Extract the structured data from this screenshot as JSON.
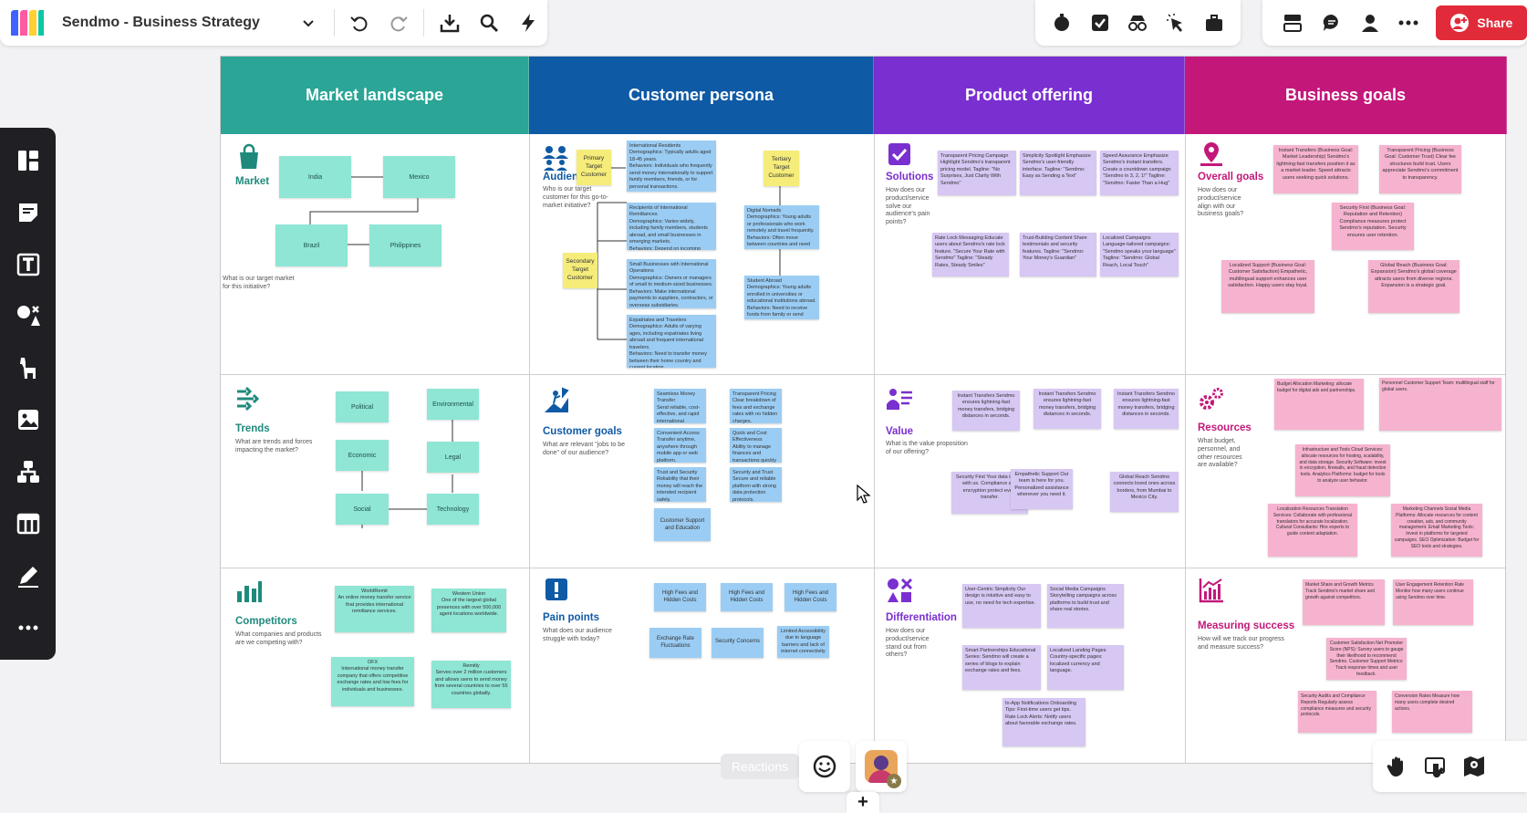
{
  "app": {
    "title": "Sendmo - Business Strategy",
    "share_label": "Share"
  },
  "toolbar": {
    "left_icons": [
      "chevron-down-icon",
      "undo-icon",
      "redo-icon",
      "download-icon",
      "search-icon",
      "lightning-icon"
    ],
    "right_icons": [
      "timer-icon",
      "checkbox-icon",
      "spy-icon",
      "pointer-icon",
      "briefcase-icon"
    ],
    "collab_icons": [
      "cards-icon",
      "chat-icon",
      "user-icon",
      "more-icon"
    ]
  },
  "sidebar": [
    "templates-icon",
    "sticky-note-icon",
    "text-icon",
    "shapes-icon",
    "llama-icon",
    "image-icon",
    "mindmap-icon",
    "table-icon",
    "pen-icon",
    "more-icon"
  ],
  "columns": [
    {
      "title": "Market landscape",
      "color": "#2aa596"
    },
    {
      "title": "Customer persona",
      "color": "#0f5aa5"
    },
    {
      "title": "Product offering",
      "color": "#7a2fd0"
    },
    {
      "title": "Business goals",
      "color": "#c3187a"
    }
  ],
  "sections": {
    "market": {
      "title": "Market",
      "q": "What is our target market for this initiative?"
    },
    "trends": {
      "title": "Trends",
      "q": "What are trends and forces impacting the market?"
    },
    "competitors": {
      "title": "Competitors",
      "q": "What companies and products are we competing with?"
    },
    "audience": {
      "title": "Audience",
      "q": "Who is our target customer for this go-to-market initiative?"
    },
    "cust_goals": {
      "title": "Customer goals",
      "q": "What are relevant \"jobs to be done\" of our audience?"
    },
    "pain": {
      "title": "Pain points",
      "q": "What does our audience struggle with today?"
    },
    "solutions": {
      "title": "Solutions",
      "q": "How does our product/service solve our audience's pain points?"
    },
    "value": {
      "title": "Value",
      "q": "What is the value proposition of our offering?"
    },
    "diff": {
      "title": "Differentiation",
      "q": "How does our product/service stand out from others?"
    },
    "overall": {
      "title": "Overall goals",
      "q": "How does our product/service align with our business goals?"
    },
    "resources": {
      "title": "Resources",
      "q": "What budget, personnel, and other resources are available?"
    },
    "measuring": {
      "title": "Measuring success",
      "q": "How will we track our progress and measure success?"
    }
  },
  "market_boxes": [
    "India",
    "Mexico",
    "Brazil",
    "Philippines"
  ],
  "trend_boxes": [
    "Political",
    "Environmental",
    "Economic",
    "Legal",
    "Social",
    "Technology"
  ],
  "competitor_notes": [
    "WorldRemit\nAn online money transfer service that provides international remittance services.",
    "Western Union\nOne of the largest global presences with over 500,000 agent locations worldwide.",
    "OFX\nInternational money transfer company that offers competitive exchange rates and low fees for individuals and businesses.",
    "Remitly\nServes over 2 million customers and allows users to send money from several countries to over 55 countries globally."
  ],
  "persona_yellow": [
    "Primary Target Customer",
    "Secondary Target Customer",
    "Tertiary Target Customer"
  ],
  "audience_notes": [
    "International Residents\nDemographics: Typically adults aged 18-45 years.\nBehaviors: Individuals who frequently send money internationally to support family members, friends, or for personal transactions.",
    "Recipients of International Remittances\nDemographics: Varies widely, including family members, students abroad, and small businesses in emerging markets.\nBehaviors: Depend on incoming remittances for personal or business expenses.",
    "Small Businesses with International Operations\nDemographics: Owners or managers of small to medium-sized businesses.\nBehaviors: Make international payments to suppliers, contractors, or overseas subsidiaries.",
    "Expatriates and Travelers\nDemographics: Adults of varying ages, including expatriates living abroad and frequent international travelers.\nBehaviors: Need to transfer money between their home country and current location.",
    "Digital Nomads\nDemographics: Young adults or professionals who work remotely and travel frequently.\nBehaviors: Often move between countries and need flexible financial tools.",
    "Student Abroad\nDemographics: Young adults enrolled in universities or educational institutions abroad.\nBehaviors: Need to receive funds from family or send money for personal expenses."
  ],
  "cust_goal_notes": [
    "Seamless Money Transfer\nSend reliable, cost-effective, and rapid international transfers that reach recipients quickly.",
    "Transparent Pricing\nClear breakdown of fees and exchange rates with no hidden charges.",
    "Convenient Access\nTransfer anytime, anywhere through mobile app or web platform.",
    "Quick and Cost Effectiveness\nAbility to manage finances and transactions quickly from anywhere in the world.",
    "Trust and Security\nReliability that their money will reach the intended recipient safely.",
    "Security and Trust\nSecure and reliable platform with strong data protection protocols.",
    "Customer Support and Education"
  ],
  "pain_notes": [
    "High Fees and Hidden Costs",
    "High Fees and Hidden Costs",
    "High Fees and Hidden Costs",
    "Exchange Rate Fluctuations",
    "Security Concerns",
    "Limited Accessibility due to language barriers and lack of internet connectivity"
  ],
  "solution_notes": [
    "Transparent Pricing Campaign\nHighlight Sendmo's transparent pricing model. Tagline: \"No Surprises, Just Clarity With Sendmo\"",
    "Simplicity Spotlight\nEmphasize Sendmo's user-friendly interface. Tagline: \"Sendmo: Easy as Sending a Text\"",
    "Speed Assurance\nEmphasize Sendmo's instant transfers. Create a countdown campaign \"Sendmo in 3, 2, 1!\" Tagline: \"Sendmo: Faster Than a Hug\"",
    "Rate Lock Messaging\nEducate users about Sendmo's rate lock feature. \"Secure Your Rate with Sendmo\" Tagline: \"Steady Rates, Steady Smiles\"",
    "Trust-Building Content\nShare testimonials and security features. Tagline: \"Sendmo: Your Money's Guardian\"",
    "Localized Campaigns\nLanguage-tailored campaigns: \"Sendmo speaks your language\" Tagline: \"Sendmo: Global Reach, Local Touch\""
  ],
  "value_notes": [
    "Instant Transfers\nSendmo ensures lightning-fast money transfers, bridging distances in seconds.",
    "Instant Transfers\nSendmo ensures lightning-fast money transfers, bridging distances in seconds.",
    "Instant Transfers\nSendmo ensures lightning-fast money transfers, bridging distances in seconds.",
    "Security First\nYour data is safe with us. Compliance and encryption protect every transfer.",
    "Empathetic Support\nOur team is here for you. Personalized assistance whenever you need it.",
    "Global Reach\nSendmo connects loved ones across borders, from Mumbai to Mexico City."
  ],
  "diff_notes": [
    "User-Centric Simplicity\nOur design is intuitive and easy to use, no need for tech expertise.",
    "Social Media Campaigns\nStorytelling campaigns across platforms to build trust and share real stories.",
    "Smart Partnerships\nEducational Series: Sendmo will create a series of blogs to explain exchange rates and fees.",
    "Localized Landing Pages\nCountry-specific pages: localized currency and language.",
    "In-App Notifications\nOnboarding Tips: First-time users get tips. Rate Lock Alerts: Notify users about favorable exchange rates."
  ],
  "overall_notes": [
    "Instant Transfers (Business Goal: Market Leadership)\nSendmo's lightning-fast transfers position it as a market leader. Speed attracts users seeking quick solutions.",
    "Transparent Pricing (Business Goal: Customer Trust)\nClear fee structures build trust. Users appreciate Sendmo's commitment to transparency.",
    "Security First (Business Goal: Reputation and Retention)\nCompliance measures protect Sendmo's reputation. Security ensures user retention.",
    "Localized Support (Business Goal: Customer Satisfaction)\nEmpathetic, multilingual support enhances user satisfaction. Happy users stay loyal.",
    "Global Reach (Business Goal: Expansion)\nSendmo's global coverage attracts users from diverse regions. Expansion is a strategic goal."
  ],
  "resource_notes": [
    "Budget Allocation\nMarketing: allocate budget for digital ads and partnerships.",
    "Personnel\nCustomer Support Team: multilingual staff for global users.",
    "Infrastructure and Tools\nCloud Services: allocate resources for hosting, scalability, and data storage. Security Software: invest in encryption, firewalls, and fraud detection tools. Analytics Platforms: budget for tools to analyze user behavior.",
    "Localization Resources\nTranslation Services: Collaborate with professional translators for accurate localization. Cultural Consultants: Hire experts to guide content adaptation.",
    "Marketing Channels\nSocial Media Platforms: Allocate resources for content creation, ads, and community management. Email Marketing Tools: invest in platforms for targeted campaigns. SEO Optimization: Budget for SEO tools and strategies."
  ],
  "measure_notes": [
    "Market Share and Growth Metrics\nTrack Sendmo's market share and growth against competitors.",
    "User Engagement Retention Rate\nMonitor how many users continue using Sendmo over time.",
    "Customer Satisfaction\nNet Promoter Score (NPS): Survey users to gauge their likelihood to recommend Sendmo. Customer Support Metrics: Track response times and user feedback.",
    "Security Audits and Compliance Reports\nRegularly assess compliance measures and security protocols.",
    "Conversion Rates\nMeasure how many users complete desired actions."
  ],
  "bottom": {
    "reactions_label": "Reactions",
    "add_label": "+"
  }
}
